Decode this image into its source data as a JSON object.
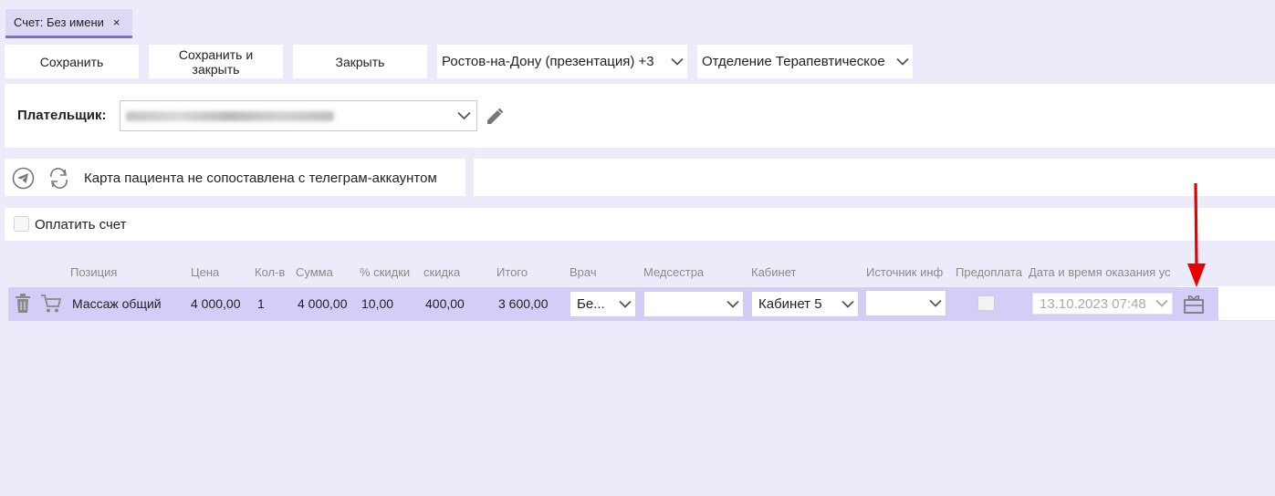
{
  "tab": {
    "title": "Счет: Без имени",
    "close": "×"
  },
  "toolbar": {
    "save": "Сохранить",
    "save_close": "Сохранить и закрыть",
    "close": "Закрыть",
    "location": "Ростов-на-Дону (презентация) +3",
    "department": "Отделение Терапевтическое"
  },
  "payer": {
    "label": "Плательщик:",
    "value": ""
  },
  "telegram": {
    "status": "Карта пациента не сопоставлена с телеграм-аккаунтом"
  },
  "pay": {
    "label": "Оплатить счет"
  },
  "table": {
    "headers": {
      "position": "Позиция",
      "price": "Цена",
      "qty": "Кол-в",
      "sum": "Сумма",
      "discount_pct": "% скидки",
      "discount": "скидка",
      "total": "Итого",
      "doctor": "Врач",
      "nurse": "Медсестра",
      "cabinet": "Кабинет",
      "source": "Источник инф",
      "prepay": "Предоплата",
      "datetime": "Дата и время оказания ус"
    },
    "rows": [
      {
        "position": "Массаж общий",
        "price": "4 000,00",
        "qty": "1",
        "sum": "4 000,00",
        "discount_pct": "10,00",
        "discount": "400,00",
        "total": "3 600,00",
        "doctor": "Бе...",
        "nurse": "",
        "cabinet": "Кабинет 5",
        "source": "",
        "datetime": "13.10.2023 07:48"
      }
    ]
  },
  "colors": {
    "accent": "#7c6fd4",
    "row_selected": "#d3cef7",
    "annotation_arrow": "#e60000"
  },
  "icons": [
    "close-icon",
    "chevron-down-icon",
    "pencil-icon",
    "telegram-icon",
    "refresh-icon",
    "trash-icon",
    "cart-icon",
    "gift-icon",
    "red-arrow-annotation"
  ]
}
